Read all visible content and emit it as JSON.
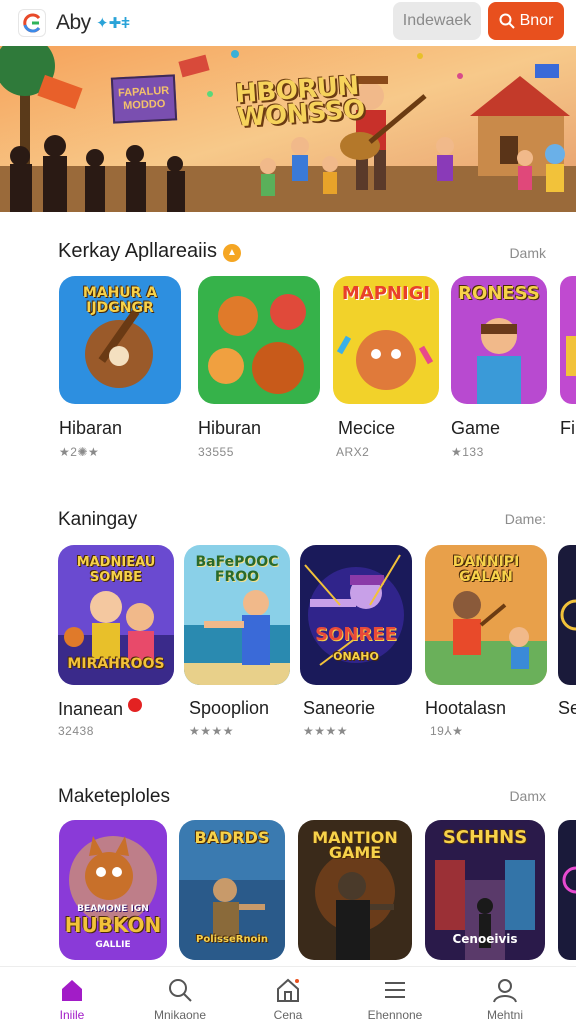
{
  "header": {
    "app_name": "Aby",
    "app_name_deco": "✦✚ǂ",
    "secondary_button": "Indewaek",
    "primary_button": "Bnor"
  },
  "banner": {
    "title_line1": "HBORUN",
    "title_line2": "WONSSO",
    "sign_text": "FAPALUR MODDO"
  },
  "sections": [
    {
      "title": "Kerkay Apllareaiis",
      "more": "Damk",
      "items": [
        {
          "name": "Hibaran",
          "meta": "★2✺★",
          "art": "MAHUR A IJDGNGR"
        },
        {
          "name": "Hiburan",
          "meta": "33555",
          "art": ""
        },
        {
          "name": "Mecice",
          "meta": "ARX2",
          "art": "MAPNIGI"
        },
        {
          "name": "Game",
          "meta": "★133",
          "art": "RONESS"
        },
        {
          "name": "Fi",
          "meta": "",
          "art": ""
        }
      ]
    },
    {
      "title": "Kaningay",
      "more": "Dame:",
      "items": [
        {
          "name": "Inanean",
          "meta": "32438",
          "art": "MADNIEAU SOMBE",
          "art2": "MIRAHROOS"
        },
        {
          "name": "Spooplion",
          "meta": "★★★★",
          "art": "BaFePOOC FROO"
        },
        {
          "name": "Saneorie",
          "meta": "★★★★",
          "art": "SONREE",
          "art2": "ONAHO"
        },
        {
          "name": "Hootalasn",
          "meta": "19⅄★",
          "art": "DANNIPI GALAN"
        },
        {
          "name": "Se",
          "meta": "",
          "art": ""
        }
      ]
    },
    {
      "title": "Maketeploles",
      "more": "Damx",
      "items": [
        {
          "name": "",
          "meta": "",
          "art": "BEAMONE IGN",
          "art2": "HUBKON",
          "art3": "GALLIE"
        },
        {
          "name": "",
          "meta": "",
          "art": "BADRDS",
          "art2": "PolisseRnoin"
        },
        {
          "name": "",
          "meta": "",
          "art": "MANTION GAME"
        },
        {
          "name": "",
          "meta": "",
          "art": "SCHHNS",
          "art2": "Cenoeivis"
        },
        {
          "name": "",
          "meta": "",
          "art": ""
        }
      ]
    }
  ],
  "nav": [
    {
      "label": "Iniile",
      "icon": "home-icon",
      "active": true
    },
    {
      "label": "Mnikaone",
      "icon": "search-icon",
      "active": false
    },
    {
      "label": "Cena",
      "icon": "store-icon",
      "active": false
    },
    {
      "label": "Ehennone",
      "icon": "menu-icon",
      "active": false
    },
    {
      "label": "Mehtni",
      "icon": "profile-icon",
      "active": false
    }
  ],
  "colors": {
    "accent": "#e8501e",
    "nav_active": "#a21cc7"
  }
}
